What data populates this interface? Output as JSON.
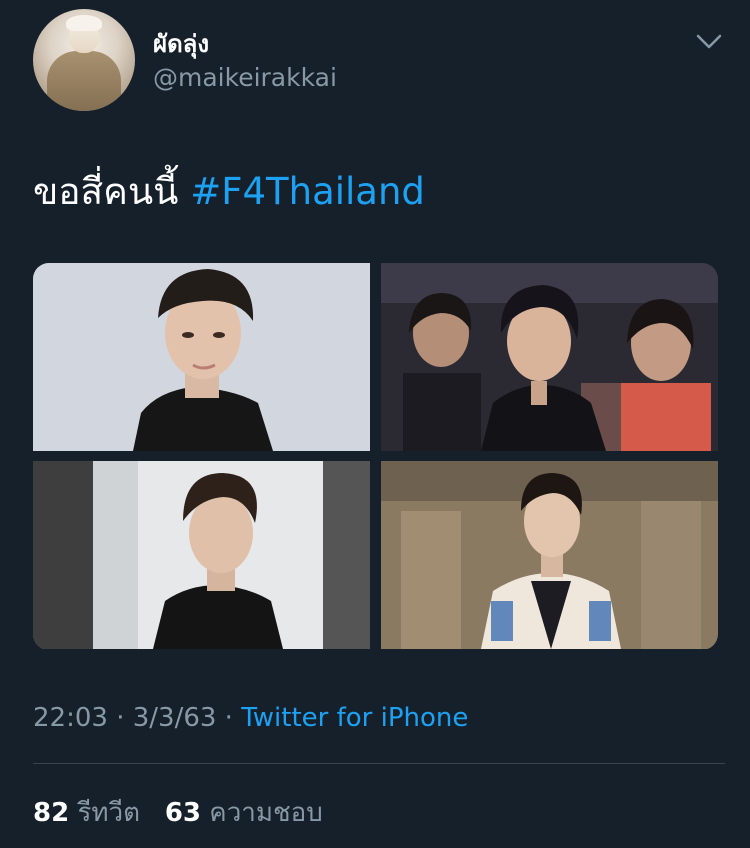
{
  "user": {
    "display_name": "ผัดลุ่ง",
    "handle": "@maikeirakkai"
  },
  "tweet": {
    "text": "ขอสี่คนนี้ ",
    "hashtag": "#F4Thailand",
    "time": "22:03",
    "date": "3/3/63",
    "separator": " · ",
    "source": "Twitter for iPhone"
  },
  "stats": {
    "retweets_count": "82",
    "retweets_label": "รีทวีต",
    "likes_count": "63",
    "likes_label": "ความชอบ"
  },
  "icons": {
    "more": "chevron-down-icon"
  },
  "colors": {
    "background": "#15202b",
    "accent": "#1da1f2",
    "secondary_text": "#8899a6",
    "divider": "#38444d"
  }
}
